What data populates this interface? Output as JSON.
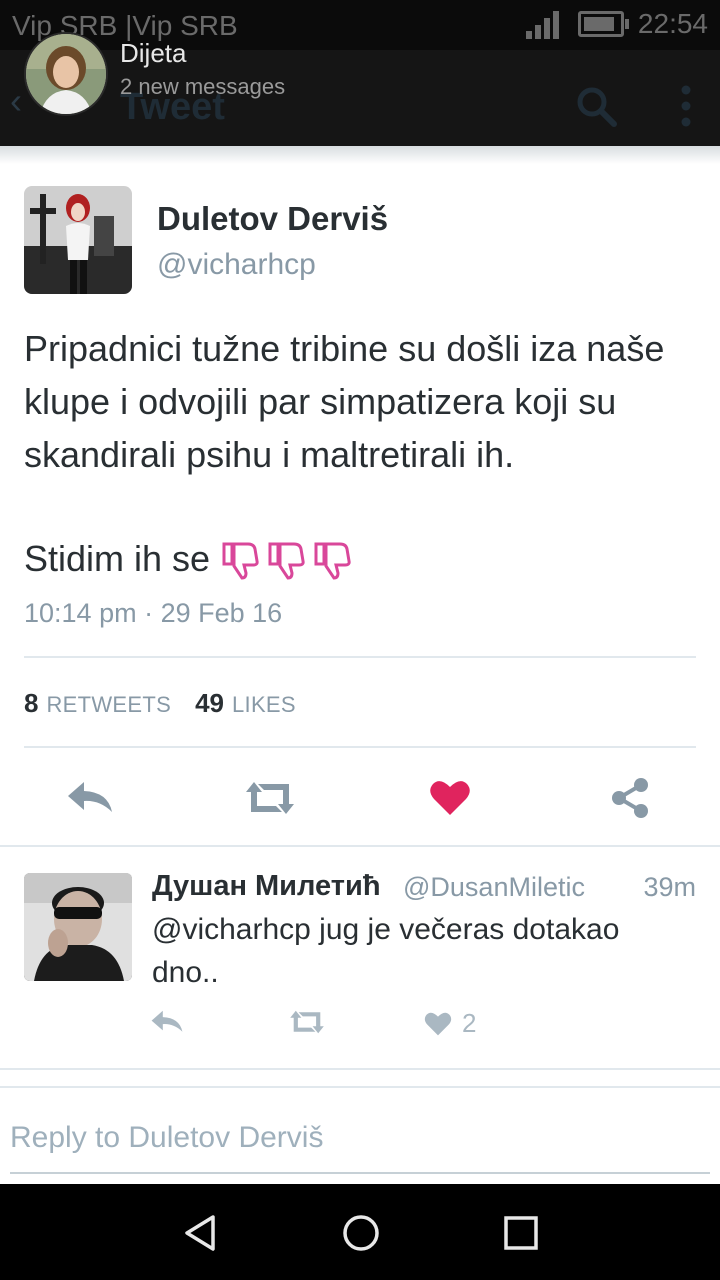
{
  "status_bar": {
    "carrier": "Vip SRB |Vip SRB",
    "time": "22:54"
  },
  "toolbar": {
    "title": "Tweet",
    "back_icon": "back-arrow-icon",
    "search_icon": "search-icon",
    "more_icon": "more-vert-icon"
  },
  "notification": {
    "title": "Dijeta",
    "subtitle": "2 new messages"
  },
  "tweet": {
    "author_name": "Duletov Derviš",
    "author_handle": "@vicharhcp",
    "text": "Pripadnici tužne tribine su došli iza naše klupe i odvojili par simpatizera koji su skandirali psihu i maltretirali ih.",
    "text2": "Stidim ih se",
    "emoji": [
      "👎",
      "👎",
      "👎"
    ],
    "timestamp": "10:14 pm · 29 Feb 16",
    "retweets_count": "8",
    "retweets_label": "RETWEETS",
    "likes_count": "49",
    "likes_label": "LIKES",
    "liked": true,
    "colors": {
      "like": "#e0245e",
      "action": "#8899a6"
    }
  },
  "reply": {
    "author_name": "Душан Милетић",
    "author_handle": "@DusanMiletic",
    "time": "39m",
    "text": "@vicharhcp jug je večeras dotakao dno..",
    "likes_count": "2"
  },
  "reply_box": {
    "placeholder": "Reply to Duletov Derviš"
  },
  "nav": {
    "back": "nav-back-icon",
    "home": "nav-home-icon",
    "recents": "nav-recents-icon"
  }
}
